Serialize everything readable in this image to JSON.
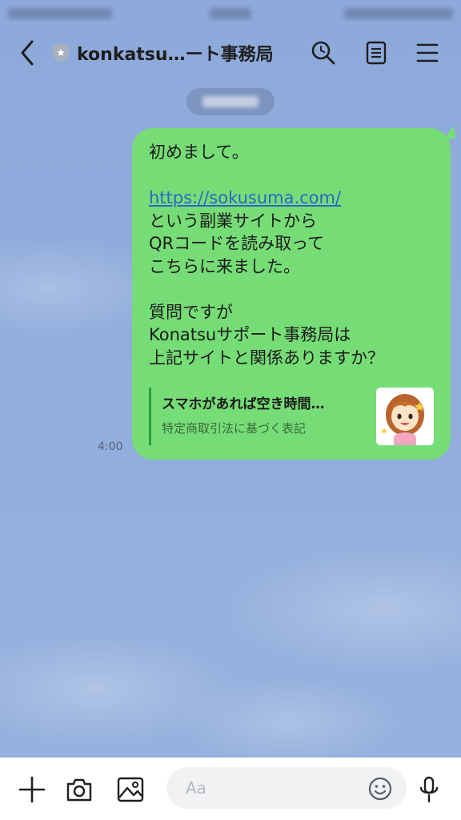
{
  "header": {
    "title": "konkatsu…ート事務局"
  },
  "message": {
    "lines": [
      "初めまして。",
      "",
      "https://sokusuma.com/",
      "という副業サイトから",
      "QRコードを読み取って",
      "こちらに来ました。",
      "",
      "質問ですが",
      "Konatsuサポート事務局は",
      "上記サイトと関係ありますか？"
    ],
    "link": "https://sokusuma.com/",
    "time": "4:00",
    "preview": {
      "title": "スマホがあれば空き時間…",
      "subtitle": "特定商取引法に基づく表記"
    }
  },
  "input": {
    "placeholder": "Aa"
  },
  "colors": {
    "background": "#8fabda",
    "bubble": "#76dd76",
    "link": "#2b66c9",
    "preview_bar": "#2d9c3c"
  },
  "icons": [
    "back-chevron-icon",
    "shield-badge-icon",
    "search-icon",
    "notes-icon",
    "menu-icon",
    "plus-icon",
    "camera-icon",
    "image-icon",
    "emoji-icon",
    "microphone-icon"
  ]
}
